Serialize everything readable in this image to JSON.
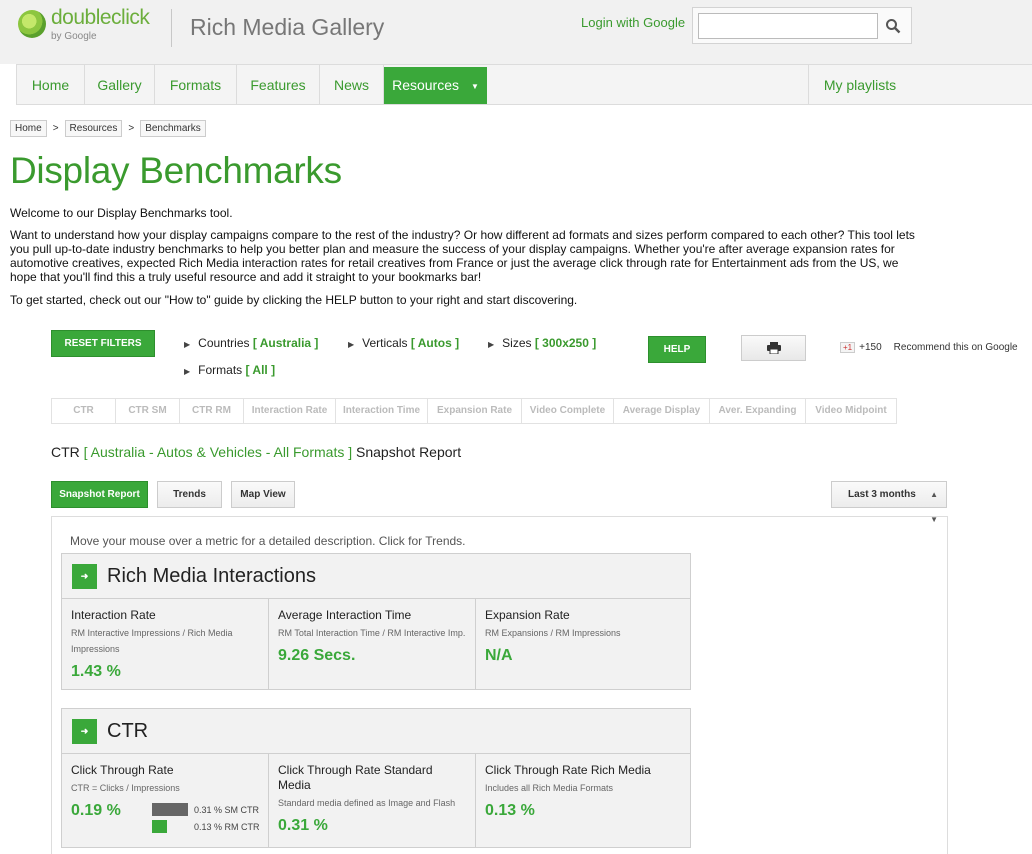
{
  "header": {
    "logo_text": "doubleclick",
    "logo_sub": "by Google",
    "site_title": "Rich Media Gallery",
    "login_label": "Login with Google",
    "search_placeholder": ""
  },
  "nav": {
    "items": [
      "Home",
      "Gallery",
      "Formats",
      "Features",
      "News",
      "Resources"
    ],
    "active": "Resources",
    "right": "My playlists"
  },
  "breadcrumb": [
    "Home",
    "Resources",
    "Benchmarks"
  ],
  "breadcrumb_sep": ">",
  "page_title": "Display Benchmarks",
  "intro": {
    "welcome": "Welcome to our Display Benchmarks tool.",
    "body_lines": [
      "Want to understand how your display campaigns compare to the rest of the industry? Or how different ad formats and sizes perform compared to each other? This tool lets",
      "you pull up-to-date industry benchmarks to help you better plan and measure the success of your display campaigns. Whether you're after average expansion rates for",
      "automotive creatives, expected Rich Media interaction rates for retail creatives from France or just the average click through rate for Entertainment ads from the US, we",
      "hope that you'll find this a truly useful resource and add it straight to your bookmarks bar!"
    ],
    "get_started": "To get started, check out our \"How to\" guide by clicking the HELP button to your right and start discovering."
  },
  "filters": {
    "reset_label": "RESET FILTERS",
    "countries_label": "Countries",
    "countries_value": "[ Australia ]",
    "verticals_label": "Verticals",
    "verticals_value": "[ Autos ]",
    "sizes_label": "Sizes",
    "sizes_value": "[ 300x250 ]",
    "formats_label": "Formats",
    "formats_value": "[ All ]",
    "help_label": "HELP",
    "gplus_badge": "+1",
    "gplus_count": "+150",
    "gplus_text": "Recommend this on Google"
  },
  "metric_tabs": [
    "CTR",
    "CTR SM",
    "CTR RM",
    "Interaction Rate",
    "Interaction Time",
    "Expansion Rate",
    "Video Complete",
    "Average Display",
    "Aver. Expanding",
    "Video Midpoint"
  ],
  "report": {
    "prefix": "CTR",
    "scope": "[ Australia - Autos & Vehicles - All Formats ]",
    "suffix": "Snapshot Report"
  },
  "views": {
    "snapshot": "Snapshot Report",
    "trends": "Trends",
    "map": "Map View",
    "range": "Last 3 months"
  },
  "hint": "Move your mouse over a metric for a detailed description. Click for Trends.",
  "sections": {
    "interactions": {
      "title": "Rich Media Interactions",
      "cells": [
        {
          "title": "Interaction Rate",
          "sub": "RM Interactive Impressions / Rich Media Impressions",
          "value": "1.43 %"
        },
        {
          "title": "Average Interaction Time",
          "sub": "RM Total Interaction Time / RM Interactive Imp.",
          "value": "9.26 Secs."
        },
        {
          "title": "Expansion Rate",
          "sub": "RM Expansions / RM Impressions",
          "value": "N/A"
        }
      ]
    },
    "ctr": {
      "title": "CTR",
      "cells": [
        {
          "title": "Click Through Rate",
          "sub": "CTR = Clicks / Impressions",
          "value": "0.19 %"
        },
        {
          "title": "Click Through Rate Standard Media",
          "sub": "Standard media defined as Image and Flash",
          "value": "0.31 %"
        },
        {
          "title": "Click Through Rate Rich Media",
          "sub": "Includes all Rich Media Formats",
          "value": "0.13 %"
        }
      ],
      "mini": {
        "sm": "0.31 % SM CTR",
        "rm": "0.13 % RM CTR"
      }
    }
  },
  "colors": {
    "accent": "#3aa83a",
    "link": "#3a9a2e"
  }
}
